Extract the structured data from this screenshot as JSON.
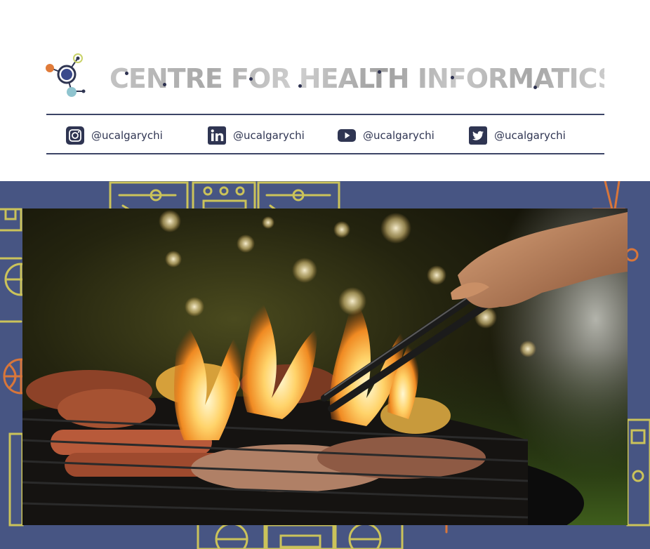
{
  "header": {
    "title": "CENTRE FOR HEALTH INFORMATICS",
    "logo_icon": "network-nodes-logo"
  },
  "social": [
    {
      "platform": "instagram",
      "icon": "instagram-icon",
      "handle": "@ucalgarychi"
    },
    {
      "platform": "linkedin",
      "icon": "linkedin-icon",
      "handle": "@ucalgarychi"
    },
    {
      "platform": "youtube",
      "icon": "youtube-icon",
      "handle": "@ucalgarychi"
    },
    {
      "platform": "twitter",
      "icon": "twitter-icon",
      "handle": "@ucalgarychi"
    }
  ],
  "photo": {
    "subject": "barbecue-grill-flames-photo"
  },
  "colors": {
    "navy": "#2f3552",
    "band_blue": "#475583",
    "pattern_yellow": "#cbc35a",
    "pattern_orange": "#d8763a",
    "logo_orange": "#e07b39",
    "logo_blue": "#3b4a8c",
    "logo_teal": "#8fc4cf",
    "logo_lime": "#c9d36a"
  }
}
